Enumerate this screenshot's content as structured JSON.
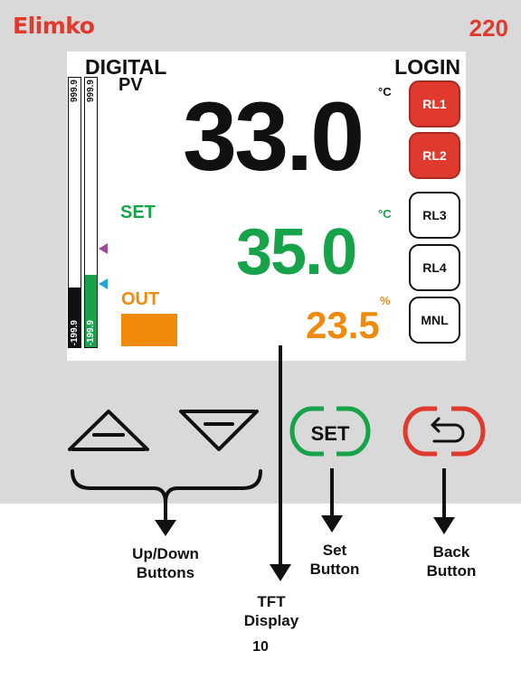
{
  "header": {
    "brand": "Elimko",
    "model": "220"
  },
  "screen": {
    "mode_label": "DIGITAL",
    "login_label": "LOGIN",
    "pv": {
      "label": "PV",
      "unit": "°C",
      "value": "33.0"
    },
    "set": {
      "label": "SET",
      "unit": "°C",
      "value": "35.0"
    },
    "out": {
      "label": "OUT",
      "unit": "%",
      "value": "23.5"
    },
    "bar_pv": {
      "max": "999.9",
      "min": "-199.9",
      "fill_fraction": 0.22
    },
    "bar_set": {
      "max": "999.9",
      "min": "-199.9",
      "fill_fraction": 0.27
    },
    "relays": [
      {
        "label": "RL1",
        "active": true
      },
      {
        "label": "RL2",
        "active": true
      },
      {
        "label": "RL3",
        "active": false
      },
      {
        "label": "RL4",
        "active": false
      },
      {
        "label": "MNL",
        "active": false
      }
    ]
  },
  "buttons": {
    "set_label": "SET"
  },
  "captions": {
    "updown": "Up/Down Buttons",
    "set": "Set Button",
    "back": "Back Button",
    "tft": "TFT Display"
  },
  "colors": {
    "brand": "#e03a2f",
    "set_green": "#16a34a",
    "out_orange": "#f08a0b",
    "marker_pv": "#a0479a",
    "marker_set": "#1ea6d6"
  },
  "icons": [
    "up-arrow-icon",
    "down-arrow-icon",
    "back-arrow-icon"
  ],
  "page_number": "10"
}
